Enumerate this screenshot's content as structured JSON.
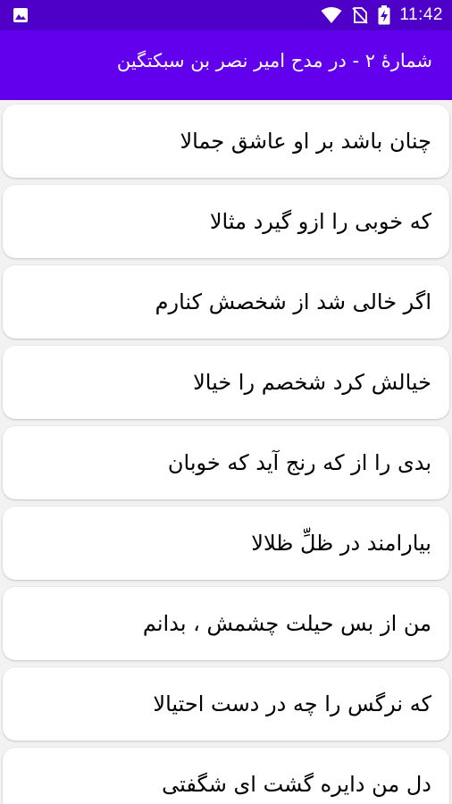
{
  "status_bar": {
    "time": "11:42",
    "icons": [
      "image-icon",
      "wifi-icon",
      "no-sim-icon",
      "battery-charging-icon"
    ],
    "color": "#4f00c8"
  },
  "app_bar": {
    "title": "شمارهٔ ۲ -  در مدح امیر نصر بن سبکتگین",
    "color": "#6200ee"
  },
  "verses": [
    "چنان باشد بر او عاشق جمالا",
    "که خوبی را ازو گیرد مثالا",
    "اگر خالی شد از شخصش کنارم",
    "خیالش کرد شخصم را خیالا",
    "بدی را از که رنج آید که خوبان",
    "بیارامند در ظلِّ ظلالا",
    "من از بس حیلت چشمش ، بدانم",
    "که نرگس را چه در دست احتیالا",
    "دل من دایره گشت ای شگفتی"
  ]
}
